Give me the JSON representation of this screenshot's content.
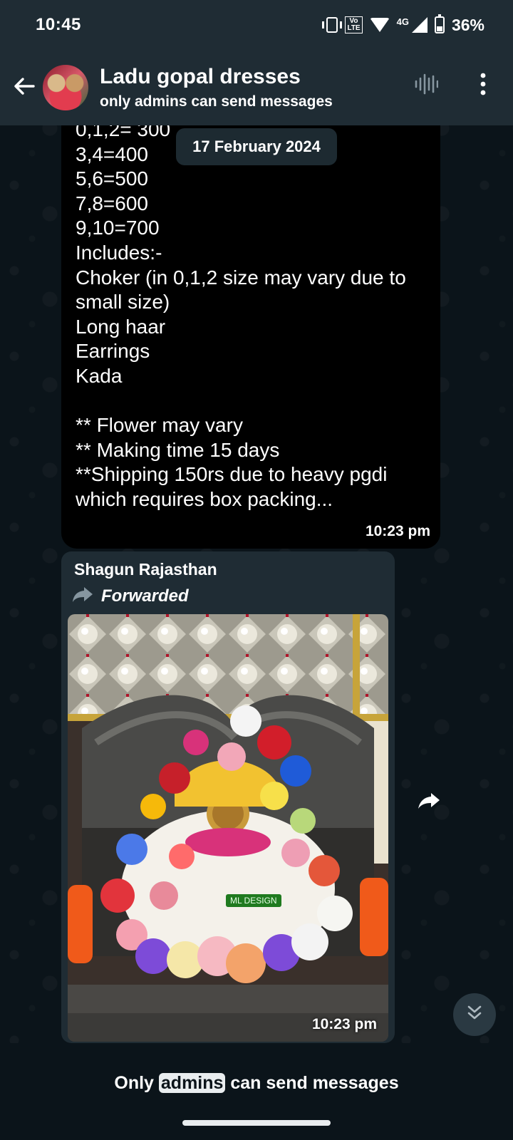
{
  "status_bar": {
    "time": "10:45",
    "network": "4G",
    "battery": "36%"
  },
  "header": {
    "title": "Ladu gopal dresses",
    "subtitle": "only admins can send messages"
  },
  "date_chip": "17 February 2024",
  "message1": {
    "lines": [
      "0,1,2= 300",
      "3,4=400",
      "5,6=500",
      "7,8=600",
      "9,10=700",
      "Includes:-",
      "Choker (in 0,1,2 size may vary due to",
      "small size)",
      "Long haar",
      "Earrings",
      "Kada",
      "",
      "** Flower may vary",
      "** Making time 15 days",
      "**Shipping 150rs due to heavy pgdi",
      "which requires box packing..."
    ],
    "time": "10:23 pm"
  },
  "message2": {
    "sender": "Shagun Rajasthan",
    "forwarded_label": "Forwarded",
    "image_watermark": "ML DESIGN",
    "time": "10:23 pm"
  },
  "footer": {
    "before": "Only ",
    "highlight": "admins",
    "after": " can send messages"
  },
  "colors": {
    "header_bg": "#1f2c34",
    "chat_bg": "#0b141a",
    "bubble_text_bg": "#000000",
    "bubble_media_bg": "#1f2c34"
  },
  "icons": [
    "back-arrow-icon",
    "voice-waveform-icon",
    "more-vert-icon",
    "forward-arrow-icon",
    "share-icon",
    "double-chevron-down-icon"
  ]
}
